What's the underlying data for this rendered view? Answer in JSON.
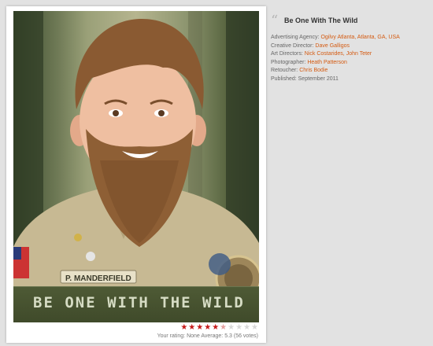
{
  "ad": {
    "banner_text": "BE ONE WITH THE WILD",
    "nametag": "P. MANDERFIELD"
  },
  "rating": {
    "stars": 5.3,
    "max": 10,
    "text": "Your rating: None Average: 5.3 (56 votes)"
  },
  "info": {
    "title": "Be One With The Wild",
    "agency_label": "Advertising Agency:",
    "agency": "Ogilvy Atlanta, Atlanta, GA, USA",
    "cd_label": "Creative Director:",
    "cd": "Dave Galligos",
    "ad_label": "Art Directors:",
    "art_directors": "Nick Costarides, John Teter",
    "photographer_label": "Photographer:",
    "photographer": "Heath Patterson",
    "retoucher_label": "Retoucher:",
    "retoucher": "Chris Bodie",
    "published": "Published: September 2011"
  },
  "icons": {
    "quote": "quote-icon",
    "star": "star-icon"
  },
  "colors": {
    "link": "#d45b12",
    "star": "#c51919"
  }
}
